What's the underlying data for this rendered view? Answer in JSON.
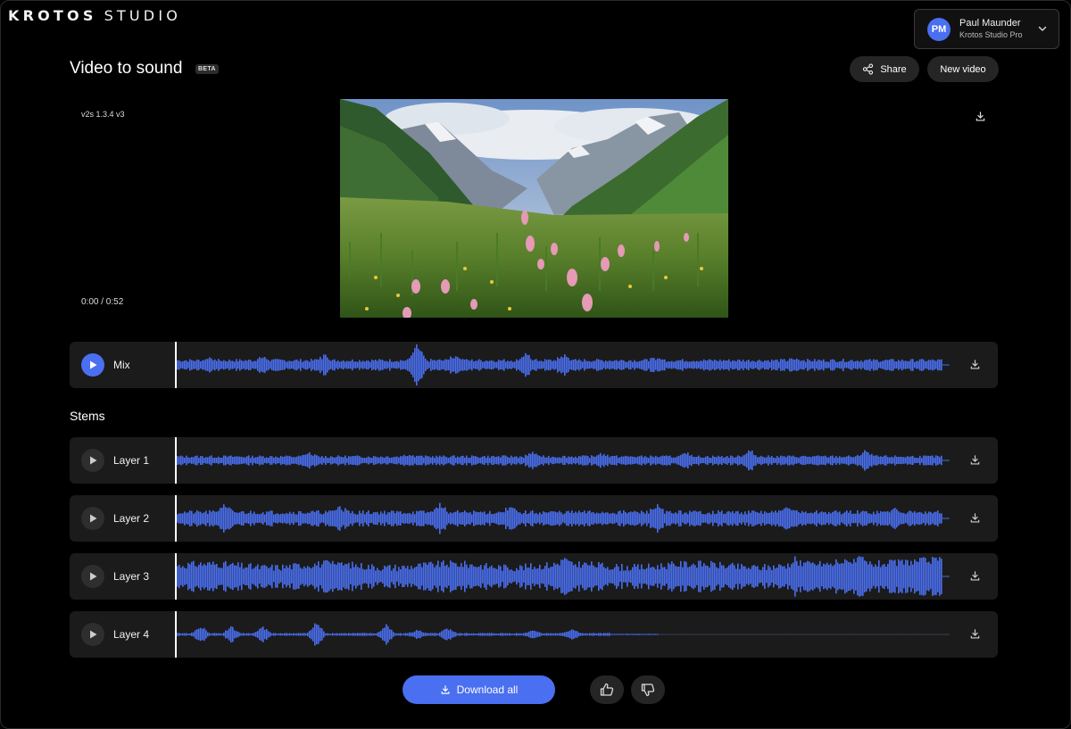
{
  "brand": {
    "logo_bold": "KROTOS",
    "logo_light": "STUDIO"
  },
  "user": {
    "initials": "PM",
    "name": "Paul Maunder",
    "plan": "Krotos Studio Pro"
  },
  "page": {
    "title": "Video to sound",
    "badge": "BETA"
  },
  "actions": {
    "share_label": "Share",
    "new_video_label": "New video"
  },
  "video": {
    "version": "v2s 1.3.4 v3",
    "timecode": "0:00 / 0:52"
  },
  "mix": {
    "label": "Mix"
  },
  "stems": {
    "heading": "Stems",
    "layers": [
      {
        "label": "Layer 1"
      },
      {
        "label": "Layer 2"
      },
      {
        "label": "Layer 3"
      },
      {
        "label": "Layer 4"
      }
    ]
  },
  "footer": {
    "download_all_label": "Download all"
  },
  "colors": {
    "accent": "#4a6ff0",
    "track_bg": "#1b1b1b",
    "pill_bg": "#252525"
  },
  "icons": {
    "download": "download-icon",
    "play": "play-icon",
    "share": "share-icon",
    "chevron": "chevron-down-icon",
    "thumbs_up": "thumbs-up-icon",
    "thumbs_down": "thumbs-down-icon"
  }
}
